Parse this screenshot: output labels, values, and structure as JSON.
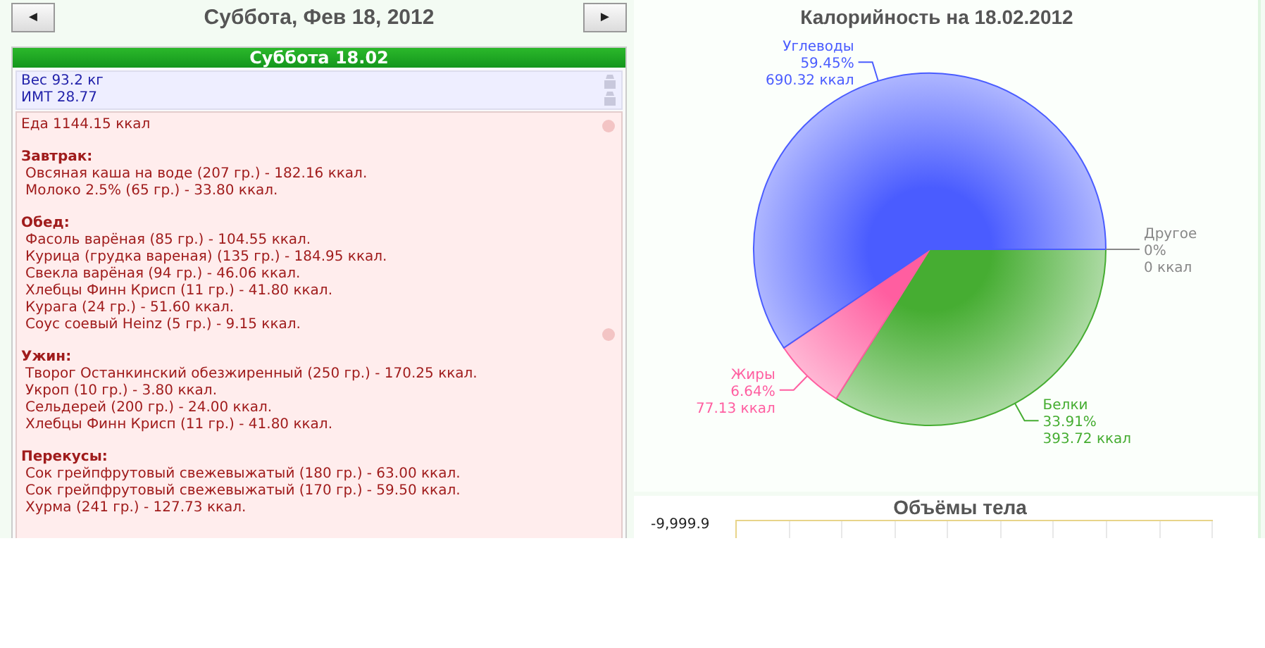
{
  "nav": {
    "prev": "◄",
    "next": "►",
    "title": "Суббота, Фев 18, 2012"
  },
  "day": {
    "header": "Суббота 18.02",
    "body": [
      "Вес 93.2 кг",
      "ИМТ 28.77"
    ],
    "food": {
      "total": "Еда 1144.15 ккал",
      "meals": [
        {
          "title": "Завтрак:",
          "items": [
            "Овсяная каша на воде (207 гр.) - 182.16 ккал.",
            "Молоко 2.5% (65 гр.) - 33.80 ккал."
          ]
        },
        {
          "title": "Обед:",
          "items": [
            "Фасоль варёная (85 гр.) - 104.55 ккал.",
            "Курица (грудка вареная) (135 гр.) - 184.95 ккал.",
            "Свекла варёная (94 гр.) - 46.06 ккал.",
            "Хлебцы Финн Крисп (11 гр.) - 41.80 ккал.",
            "Курага (24 гр.) - 51.60 ккал.",
            "Соус соевый Heinz (5 гр.) - 9.15 ккал."
          ]
        },
        {
          "title": "Ужин:",
          "items": [
            "Творог Останкинский обезжиренный (250 гр.) - 170.25 ккал.",
            "Укроп (10 гр.) - 3.80 ккал.",
            "Сельдерей (200 гр.) - 24.00 ккал.",
            "Хлебцы Финн Крисп (11 гр.) - 41.80 ккал."
          ]
        },
        {
          "title": "Перекусы:",
          "items": [
            "Сок грейпфрутовый свежевыжатый (180 гр.) - 63.00 ккал.",
            "Сок грейпфрутовый свежевыжатый (170 гр.) - 59.50 ккал.",
            "Хурма (241 гр.) - 127.73 ккал."
          ]
        }
      ]
    }
  },
  "calorie_chart": {
    "chart_data": {
      "type": "pie",
      "title": "Калорийность на 18.02.2012",
      "categories": [
        "Белки",
        "Жиры",
        "Углеводы",
        "Другое"
      ],
      "values": [
        33.91,
        6.64,
        59.45,
        0
      ],
      "colors": [
        "#46ad32",
        "#ff5ea0",
        "#4a5cff",
        "#888888"
      ]
    },
    "slice_labels": [
      {
        "percent": "33.91%",
        "kcal": "393.72 ккал"
      },
      {
        "percent": "6.64%",
        "kcal": "77.13 ккал"
      },
      {
        "percent": "59.45%",
        "kcal": "690.32 ккал"
      },
      {
        "percent": "0%",
        "kcal": "0 ккал"
      }
    ]
  },
  "volume_chart": {
    "title": "Объёмы тела",
    "axis_label": "-9,999.9"
  }
}
